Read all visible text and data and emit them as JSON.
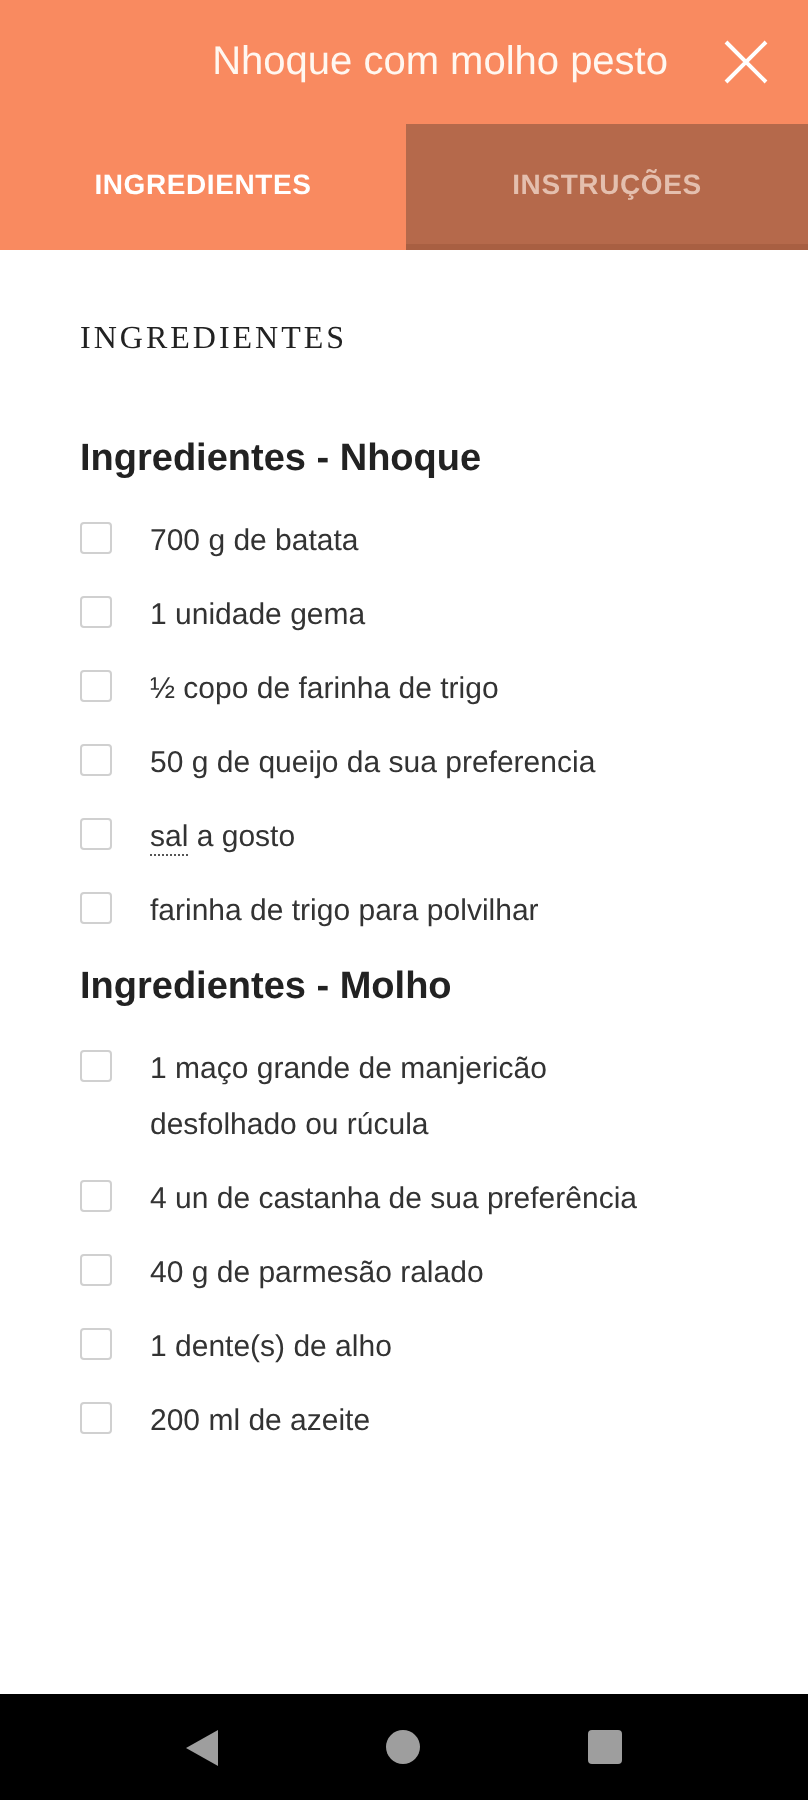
{
  "header": {
    "title": "Nhoque com molho pesto"
  },
  "tabs": [
    {
      "label": "INGREDIENTES",
      "selected": true
    },
    {
      "label": "INSTRUÇÕES",
      "selected": false
    }
  ],
  "section_title": "INGREDIENTES",
  "groups": [
    {
      "heading": "Ingredientes - Nhoque",
      "items": [
        {
          "text": "700 g de batata",
          "checked": false
        },
        {
          "text": "1 unidade gema",
          "checked": false
        },
        {
          "text": "½ copo de farinha de trigo",
          "checked": false
        },
        {
          "text": "50 g de queijo da sua preferencia",
          "checked": false
        },
        {
          "link": "sal",
          "text": "a gosto",
          "checked": false
        },
        {
          "text": "farinha de trigo para polvilhar",
          "checked": false
        }
      ]
    },
    {
      "heading": "Ingredientes - Molho",
      "items": [
        {
          "text": "1 maço grande de manjericão desfolhado ou rúcula",
          "checked": false
        },
        {
          "text": "4 un de castanha de sua preferência",
          "checked": false
        },
        {
          "text": "40 g de parmesão ralado",
          "checked": false
        },
        {
          "text": "1 dente(s) de alho",
          "checked": false
        },
        {
          "text": "200 ml de azeite",
          "checked": false
        }
      ]
    }
  ]
}
